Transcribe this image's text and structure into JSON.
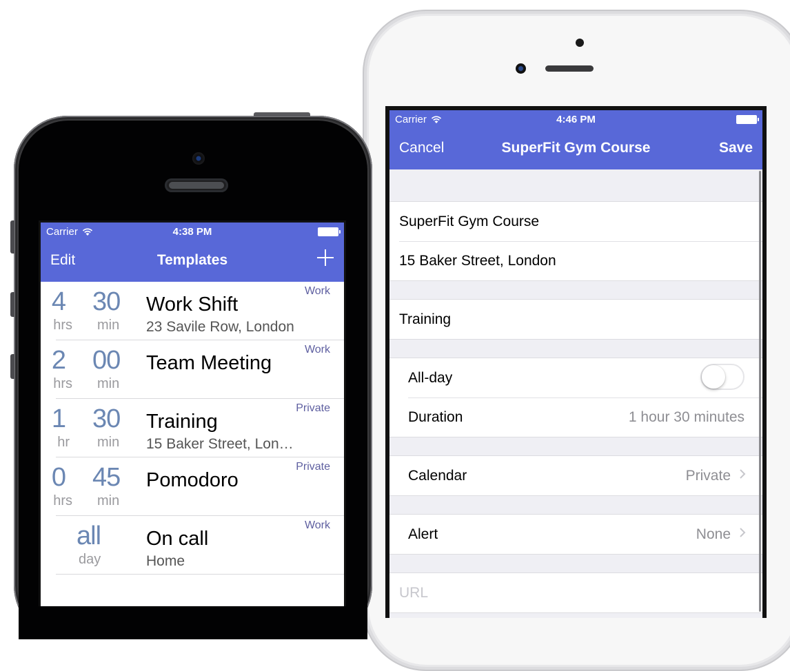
{
  "colors": {
    "accent": "#5868d8",
    "duration": "#6b87b3",
    "calendar": "#5e5fa0"
  },
  "left_phone": {
    "status_bar": {
      "carrier": "Carrier",
      "time": "4:38 PM"
    },
    "nav": {
      "left": "Edit",
      "title": "Templates",
      "right_icon": "plus-icon",
      "right": "+"
    },
    "templates": [
      {
        "hours": "4",
        "hours_unit": "hrs",
        "minutes": "30",
        "minutes_unit": "min",
        "title": "Work Shift",
        "subtitle": "23 Savile Row, London",
        "calendar": "Work"
      },
      {
        "hours": "2",
        "hours_unit": "hrs",
        "minutes": "00",
        "minutes_unit": "min",
        "title": "Team Meeting",
        "subtitle": "",
        "calendar": "Work"
      },
      {
        "hours": "1",
        "hours_unit": "hr",
        "minutes": "30",
        "minutes_unit": "min",
        "title": "Training",
        "subtitle": "15 Baker Street, Lon…",
        "calendar": "Private"
      },
      {
        "hours": "0",
        "hours_unit": "hrs",
        "minutes": "45",
        "minutes_unit": "min",
        "title": "Pomodoro",
        "subtitle": "",
        "calendar": "Private"
      },
      {
        "allday": "all",
        "allday_unit": "day",
        "title": "On call",
        "subtitle": "Home",
        "calendar": "Work"
      }
    ]
  },
  "right_phone": {
    "status_bar": {
      "carrier": "Carrier",
      "time": "4:46 PM"
    },
    "nav": {
      "left": "Cancel",
      "title": "SuperFit Gym Course",
      "right": "Save"
    },
    "form": {
      "title_value": "SuperFit Gym Course",
      "location_value": "15 Baker Street, London",
      "notes_value": "Training",
      "allday_label": "All-day",
      "allday_on": false,
      "duration_label": "Duration",
      "duration_value": "1 hour 30 minutes",
      "calendar_label": "Calendar",
      "calendar_value": "Private",
      "alert_label": "Alert",
      "alert_value": "None",
      "url_placeholder": "URL"
    }
  }
}
